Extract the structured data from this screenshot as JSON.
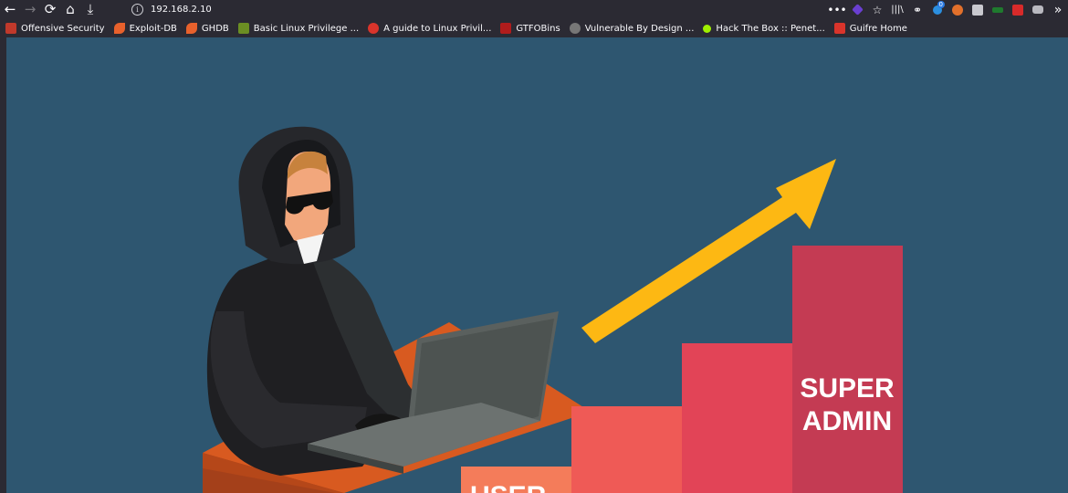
{
  "browser": {
    "url": "192.168.2.10",
    "nav": {
      "back_icon": "←",
      "forward_icon": "→",
      "reload_icon": "⟳",
      "home_icon": "⌂",
      "download_icon": "⤓"
    },
    "toolbar": {
      "more_icon": "•••",
      "bookmark_star_icon": "☆",
      "library_icon": "|||\\",
      "overflow_icon": "»",
      "badge_count": "0"
    }
  },
  "bookmarks": [
    {
      "label": "Offensive Security",
      "color": "#c0392b"
    },
    {
      "label": "Exploit-DB",
      "color": "#e8612c"
    },
    {
      "label": "GHDB",
      "color": "#e8612c"
    },
    {
      "label": "Basic Linux Privilege ...",
      "color": "#6b8e23"
    },
    {
      "label": "A guide to Linux Privil...",
      "color": "#d9342b"
    },
    {
      "label": "GTFOBins",
      "color": "#b01c1c"
    },
    {
      "label": "Vulnerable By Design ...",
      "color": "#777777"
    },
    {
      "label": "Hack The Box :: Penet...",
      "color": "#9fef00"
    },
    {
      "label": "Guifre Home",
      "color": "#d9342b"
    }
  ],
  "illustration": {
    "top_block_text_line1": "SUPER",
    "top_block_text_line2": "ADMIN",
    "bottom_block_text": "USER",
    "colors": {
      "background": "#2e5670",
      "arrow": "#fdb813",
      "desk": "#d85a20",
      "step1": "#f47c5a",
      "step2": "#ef5a56",
      "step3": "#e24457",
      "step4": "#c43b53"
    }
  }
}
